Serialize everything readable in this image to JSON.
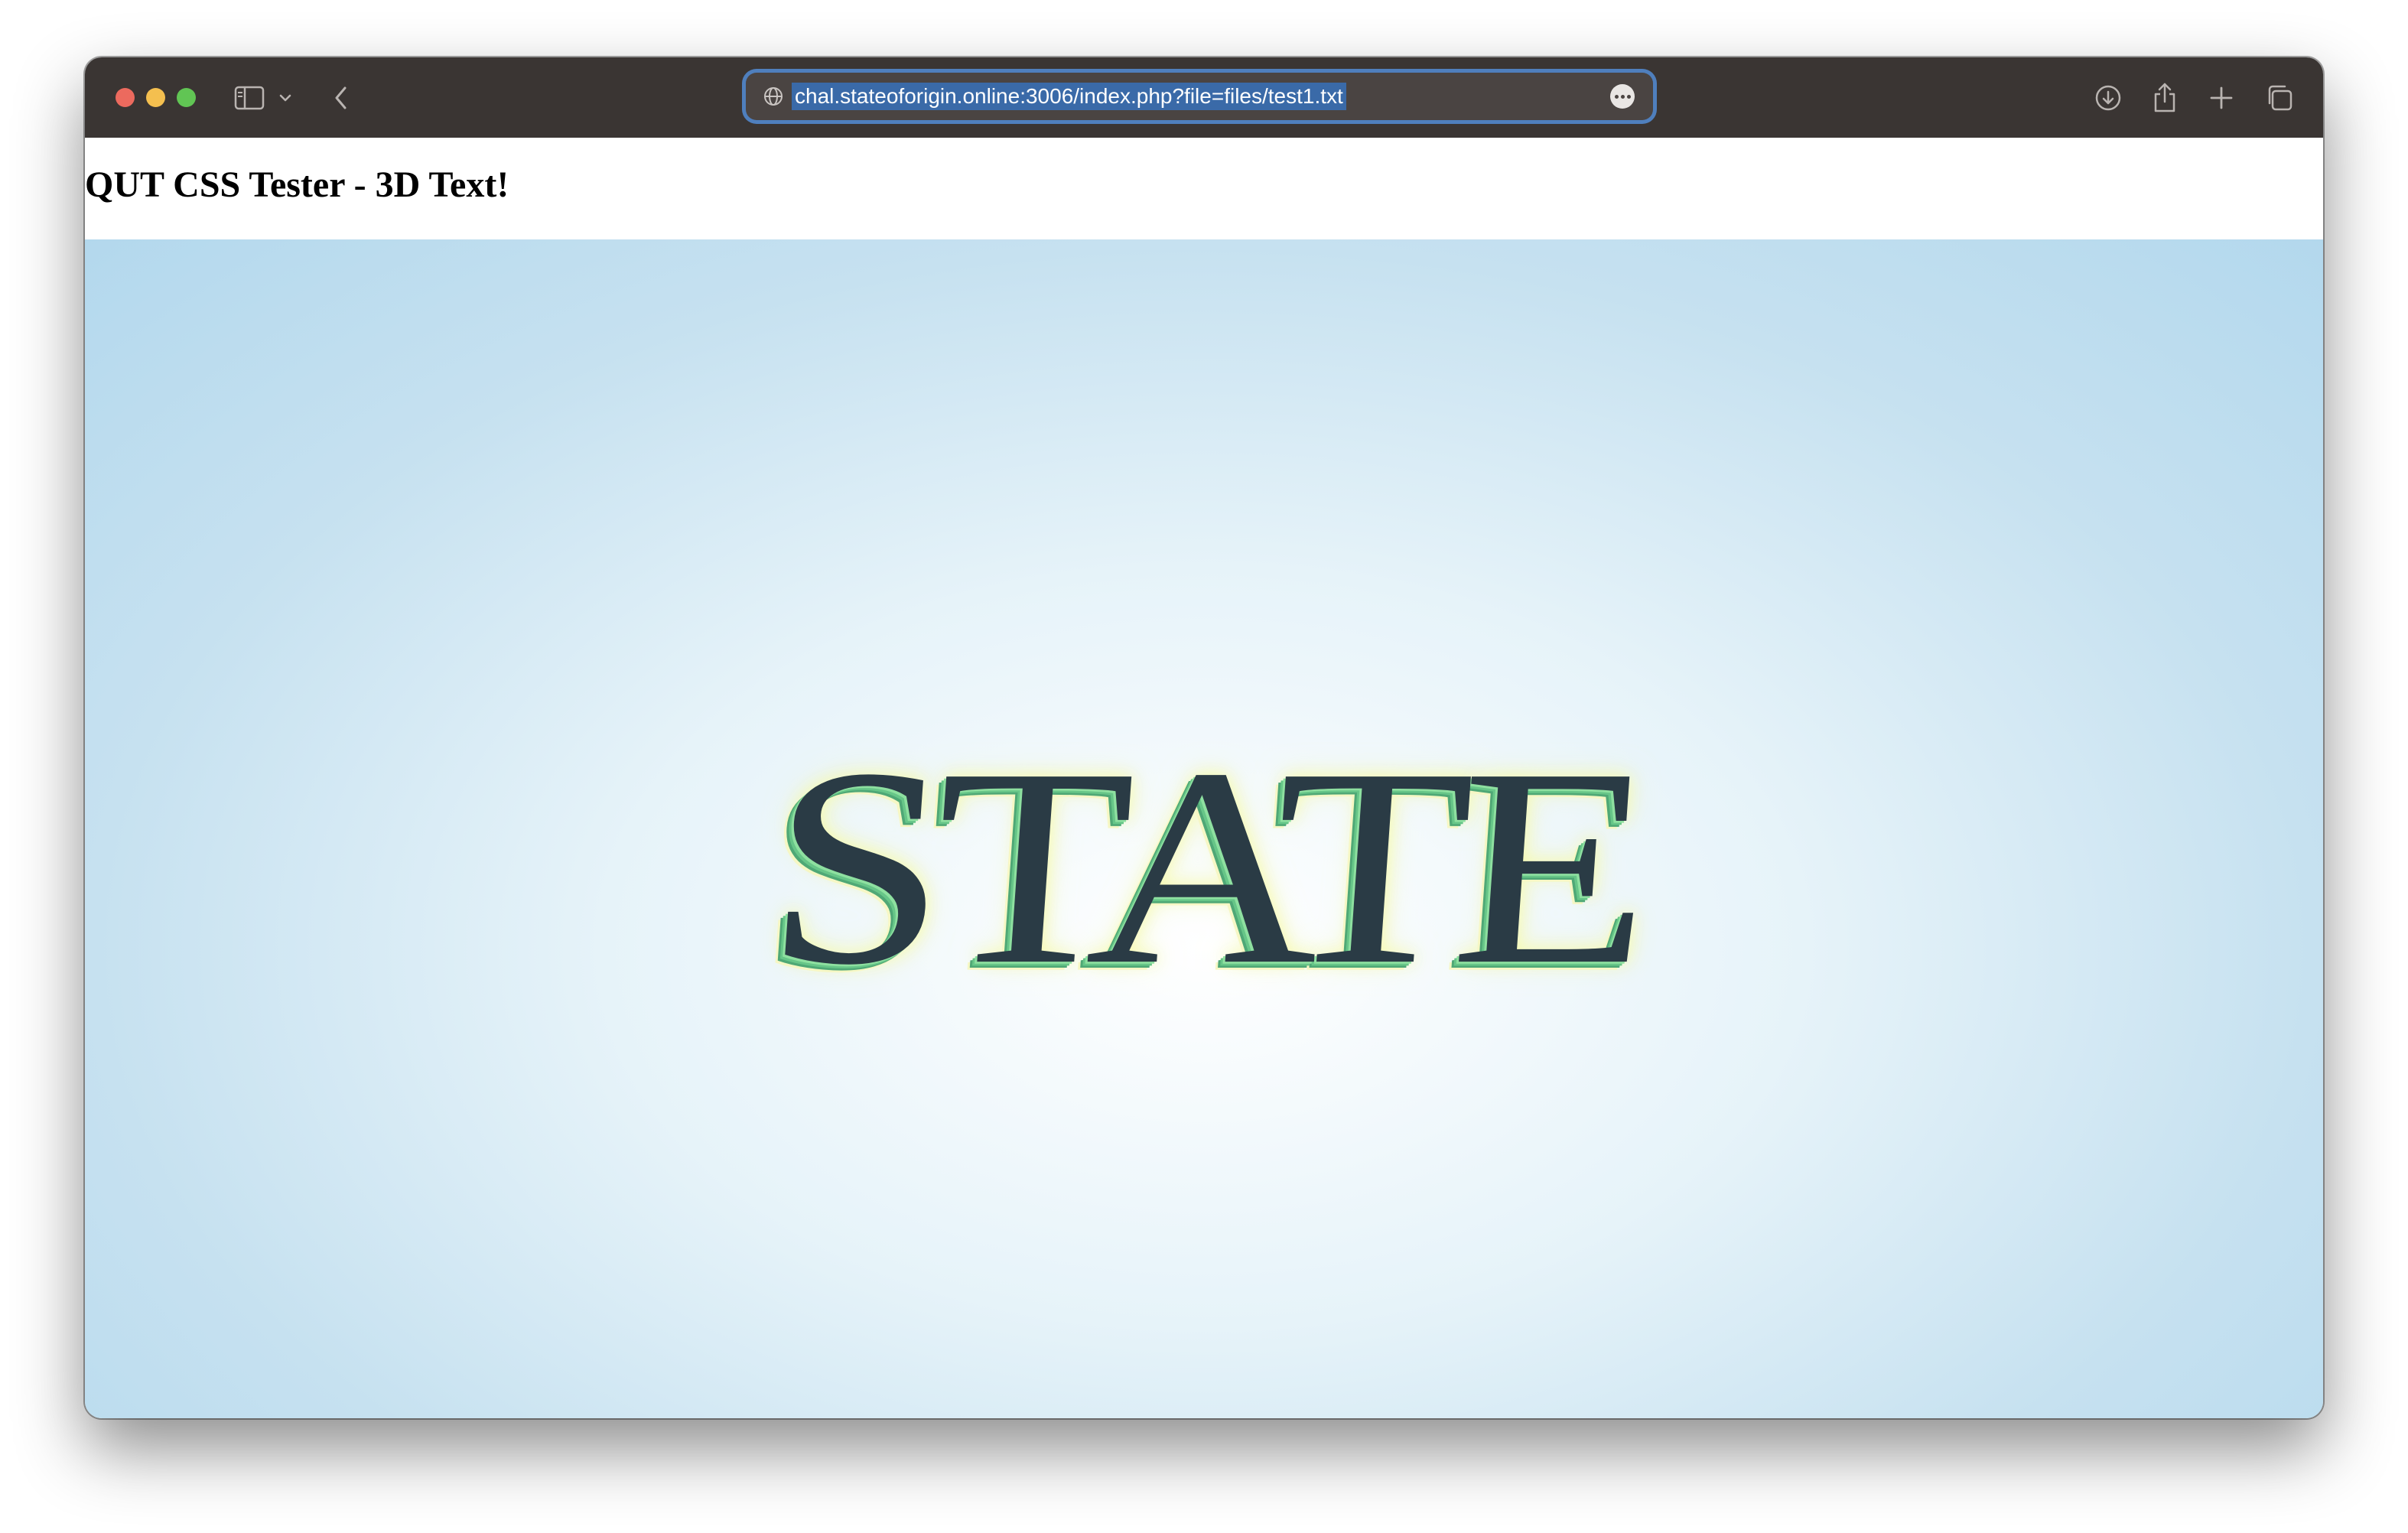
{
  "browser": {
    "url": "chal.stateoforigin.online:3006/index.php?file=files/test1.txt",
    "icons": {
      "sidebar": "sidebar-icon",
      "chevron": "chevron-down-icon",
      "back": "back-arrow-icon",
      "site": "globe-icon",
      "more": "more-icon",
      "download": "download-icon",
      "share": "share-icon",
      "new_tab": "plus-icon",
      "tabs": "tabs-overview-icon"
    }
  },
  "page": {
    "title": "QUT CSS Tester - 3D Text!",
    "display_text": "STATE",
    "colors": {
      "text": "#2a3b45",
      "extrusion": "#67c688",
      "glow": "#f6f7c4",
      "background_center": "#ffffff",
      "background_edge": "#b3d8ed"
    }
  }
}
